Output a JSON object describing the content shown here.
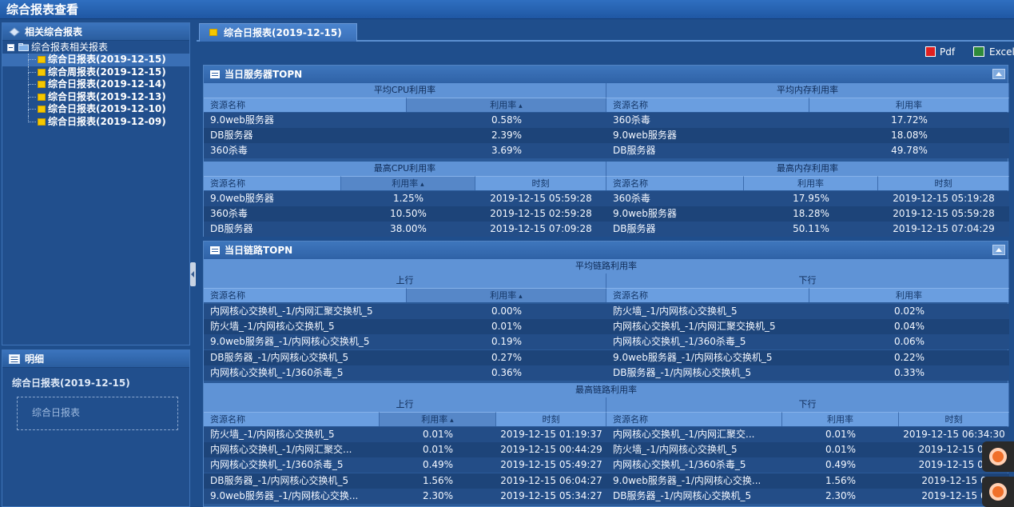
{
  "window": {
    "title": "综合报表查看"
  },
  "left_tree": {
    "header": "相关综合报表",
    "root": "综合报表相关报表",
    "items": [
      {
        "label": "综合日报表(2019-12-15)",
        "selected": true
      },
      {
        "label": "综合周报表(2019-12-15)",
        "selected": false
      },
      {
        "label": "综合日报表(2019-12-14)",
        "selected": false
      },
      {
        "label": "综合日报表(2019-12-13)",
        "selected": false
      },
      {
        "label": "综合日报表(2019-12-10)",
        "selected": false
      },
      {
        "label": "综合日报表(2019-12-09)",
        "selected": false
      }
    ]
  },
  "detail": {
    "header": "明细",
    "title": "综合日报表(2019-12-15)",
    "box_text": "综合日报表"
  },
  "tabs": [
    {
      "label": "综合日报表(2019-12-15)"
    }
  ],
  "toolbar": {
    "pdf": "Pdf",
    "excel": "Excel"
  },
  "server_section": {
    "title": "当日服务器TOPN",
    "avg_cpu": {
      "group": "平均CPU利用率",
      "col_name": "资源名称",
      "col_rate": "利用率",
      "rows": [
        [
          "9.0web服务器",
          "0.58%"
        ],
        [
          "DB服务器",
          "2.39%"
        ],
        [
          "360杀毒",
          "3.69%"
        ]
      ]
    },
    "avg_mem": {
      "group": "平均内存利用率",
      "col_name": "资源名称",
      "col_rate": "利用率",
      "rows": [
        [
          "360杀毒",
          "17.72%"
        ],
        [
          "9.0web服务器",
          "18.08%"
        ],
        [
          "DB服务器",
          "49.78%"
        ]
      ]
    },
    "max_cpu": {
      "group": "最高CPU利用率",
      "col_name": "资源名称",
      "col_rate": "利用率",
      "col_time": "时刻",
      "rows": [
        [
          "9.0web服务器",
          "1.25%",
          "2019-12-15 05:59:28"
        ],
        [
          "360杀毒",
          "10.50%",
          "2019-12-15 02:59:28"
        ],
        [
          "DB服务器",
          "38.00%",
          "2019-12-15 07:09:28"
        ]
      ]
    },
    "max_mem": {
      "group": "最高内存利用率",
      "col_name": "资源名称",
      "col_rate": "利用率",
      "col_time": "时刻",
      "rows": [
        [
          "360杀毒",
          "17.95%",
          "2019-12-15 05:19:28"
        ],
        [
          "9.0web服务器",
          "18.28%",
          "2019-12-15 05:59:28"
        ],
        [
          "DB服务器",
          "50.11%",
          "2019-12-15 07:04:29"
        ]
      ]
    }
  },
  "link_section": {
    "title": "当日链路TOPN",
    "avg_group": "平均链路利用率",
    "max_group": "最高链路利用率",
    "up": "上行",
    "down": "下行",
    "col_name": "资源名称",
    "col_rate": "利用率",
    "col_time": "时刻",
    "avg_up_rows": [
      [
        "内网核心交换机_-1/内网汇聚交换机_5",
        "0.00%"
      ],
      [
        "防火墙_-1/内网核心交换机_5",
        "0.01%"
      ],
      [
        "9.0web服务器_-1/内网核心交换机_5",
        "0.19%"
      ],
      [
        "DB服务器_-1/内网核心交换机_5",
        "0.27%"
      ],
      [
        "内网核心交换机_-1/360杀毒_5",
        "0.36%"
      ]
    ],
    "avg_down_rows": [
      [
        "防火墙_-1/内网核心交换机_5",
        "0.02%"
      ],
      [
        "内网核心交换机_-1/内网汇聚交换机_5",
        "0.04%"
      ],
      [
        "内网核心交换机_-1/360杀毒_5",
        "0.06%"
      ],
      [
        "9.0web服务器_-1/内网核心交换机_5",
        "0.22%"
      ],
      [
        "DB服务器_-1/内网核心交换机_5",
        "0.33%"
      ]
    ],
    "max_up_rows": [
      [
        "防火墙_-1/内网核心交换机_5",
        "0.01%",
        "2019-12-15 01:19:37"
      ],
      [
        "内网核心交换机_-1/内网汇聚交...",
        "0.01%",
        "2019-12-15 00:44:29"
      ],
      [
        "内网核心交换机_-1/360杀毒_5",
        "0.49%",
        "2019-12-15 05:49:27"
      ],
      [
        "DB服务器_-1/内网核心交换机_5",
        "1.56%",
        "2019-12-15 06:04:27"
      ],
      [
        "9.0web服务器_-1/内网核心交换...",
        "2.30%",
        "2019-12-15 05:34:27"
      ]
    ],
    "max_down_rows": [
      [
        "内网核心交换机_-1/内网汇聚交...",
        "0.01%",
        "2019-12-15 06:34:30"
      ],
      [
        "防火墙_-1/内网核心交换机_5",
        "0.01%",
        "2019-12-15 00"
      ],
      [
        "内网核心交换机_-1/360杀毒_5",
        "0.49%",
        "2019-12-15 06"
      ],
      [
        "9.0web服务器_-1/内网核心交换...",
        "1.56%",
        "2019-12-15 0"
      ],
      [
        "DB服务器_-1/内网核心交换机_5",
        "2.30%",
        "2019-12-15 0"
      ]
    ]
  }
}
